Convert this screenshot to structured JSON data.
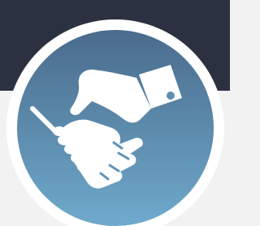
{
  "icon": {
    "name": "handshake-icon",
    "colors": {
      "background_dark": "#2b3140",
      "background_light": "#f2f2f2",
      "ring": "#ffffff",
      "circle_top": "#4a6d8e",
      "circle_bottom": "#6ea9cc",
      "glyph": "#ffffff"
    }
  }
}
